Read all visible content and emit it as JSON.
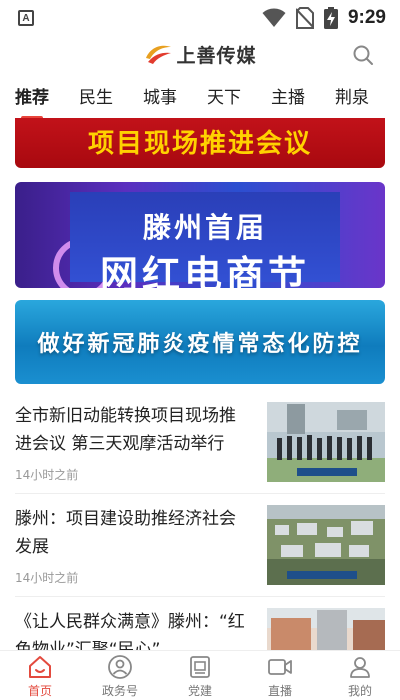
{
  "status_bar": {
    "time": "9:29",
    "app_badge": "A"
  },
  "header": {
    "logo_text": "上善传媒",
    "search_icon": "search-icon"
  },
  "tabs": [
    {
      "label": "推荐",
      "active": true
    },
    {
      "label": "民生",
      "active": false
    },
    {
      "label": "城事",
      "active": false
    },
    {
      "label": "天下",
      "active": false
    },
    {
      "label": "主播",
      "active": false
    },
    {
      "label": "荆泉",
      "active": false
    }
  ],
  "banners": [
    {
      "text": "项目现场推进会议"
    },
    {
      "line1": "滕州首届",
      "line2": "网红电商节"
    },
    {
      "text": "做好新冠肺炎疫情常态化防控"
    }
  ],
  "articles": [
    {
      "title": "全市新旧动能转换项目现场推进会议 第三天观摩活动举行",
      "time": "14小时之前"
    },
    {
      "title": "滕州：项目建设助推经济社会发展",
      "time": "14小时之前"
    },
    {
      "title": "《让人民群众满意》滕州：“红色物业”汇聚“民心”",
      "time": ""
    }
  ],
  "bottom_nav": [
    {
      "label": "首页",
      "icon": "home-icon",
      "active": true
    },
    {
      "label": "政务号",
      "icon": "government-account-icon",
      "active": false
    },
    {
      "label": "党建",
      "icon": "party-building-icon",
      "active": false
    },
    {
      "label": "直播",
      "icon": "live-video-icon",
      "active": false
    },
    {
      "label": "我的",
      "icon": "profile-icon",
      "active": false
    }
  ],
  "colors": {
    "accent": "#e34a3e",
    "tab_underline": "#e8453c",
    "text_primary": "#222222",
    "text_secondary": "#999999"
  }
}
